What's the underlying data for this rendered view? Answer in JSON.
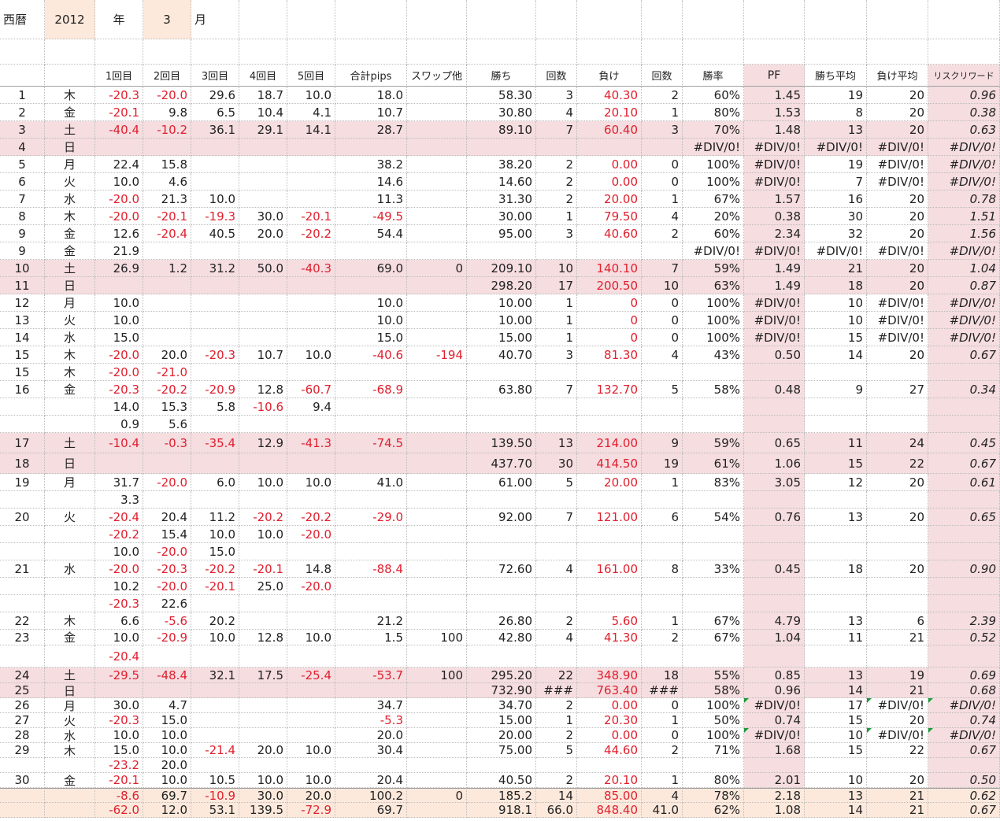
{
  "top": {
    "label_era": "西暦",
    "year": "2012",
    "label_year": "年",
    "month": "3",
    "label_month": "月"
  },
  "columns": [
    "",
    "",
    "1回目",
    "2回目",
    "3回目",
    "4回目",
    "5回目",
    "合計pips",
    "スワップ他",
    "勝ち",
    "回数",
    "負け",
    "回数",
    "勝率",
    "PF",
    "勝ち平均",
    "負け平均",
    "リスクリワード"
  ],
  "rows": [
    {
      "h": 22,
      "bg": "",
      "c": [
        "1",
        "木",
        "-20.3",
        "-20.0",
        "29.6",
        "18.7",
        "10.0",
        "18.0",
        "",
        "58.30",
        "3",
        "40.30",
        "2",
        "60%",
        "1.45",
        "19",
        "20",
        "0.96"
      ]
    },
    {
      "h": 22,
      "bg": "",
      "c": [
        "2",
        "金",
        "-20.1",
        "9.8",
        "6.5",
        "10.4",
        "4.1",
        "10.7",
        "",
        "30.80",
        "4",
        "20.10",
        "1",
        "80%",
        "1.53",
        "8",
        "20",
        "0.38"
      ]
    },
    {
      "h": 22,
      "bg": "pink",
      "c": [
        "3",
        "土",
        "-40.4",
        "-10.2",
        "36.1",
        "29.1",
        "14.1",
        "28.7",
        "",
        "89.10",
        "7",
        "60.40",
        "3",
        "70%",
        "1.48",
        "13",
        "20",
        "0.63"
      ]
    },
    {
      "h": 22,
      "bg": "pink",
      "c": [
        "4",
        "日",
        "",
        "",
        "",
        "",
        "",
        "",
        "",
        "",
        "",
        "",
        "",
        "#DIV/0!",
        "#DIV/0!",
        "#DIV/0!",
        "#DIV/0!",
        "#DIV/0!"
      ]
    },
    {
      "h": 22,
      "bg": "",
      "c": [
        "5",
        "月",
        "22.4",
        "15.8",
        "",
        "",
        "",
        "38.2",
        "",
        "38.20",
        "2",
        "0.00",
        "0",
        "100%",
        "#DIV/0!",
        "19",
        "#DIV/0!",
        "#DIV/0!"
      ]
    },
    {
      "h": 22,
      "bg": "",
      "c": [
        "6",
        "火",
        "10.0",
        "4.6",
        "",
        "",
        "",
        "14.6",
        "",
        "14.60",
        "2",
        "0.00",
        "0",
        "100%",
        "#DIV/0!",
        "7",
        "#DIV/0!",
        "#DIV/0!"
      ]
    },
    {
      "h": 22,
      "bg": "",
      "c": [
        "7",
        "水",
        "-20.0",
        "21.3",
        "10.0",
        "",
        "",
        "11.3",
        "",
        "31.30",
        "2",
        "20.00",
        "1",
        "67%",
        "1.57",
        "16",
        "20",
        "0.78"
      ]
    },
    {
      "h": 22,
      "bg": "",
      "c": [
        "8",
        "木",
        "-20.0",
        "-20.1",
        "-19.3",
        "30.0",
        "-20.1",
        "-49.5",
        "",
        "30.00",
        "1",
        "79.50",
        "4",
        "20%",
        "0.38",
        "30",
        "20",
        "1.51"
      ]
    },
    {
      "h": 22,
      "bg": "",
      "c": [
        "9",
        "金",
        "12.6",
        "-20.4",
        "40.5",
        "20.0",
        "-20.2",
        "54.4",
        "",
        "95.00",
        "3",
        "40.60",
        "2",
        "60%",
        "2.34",
        "32",
        "20",
        "1.56"
      ]
    },
    {
      "h": 22,
      "bg": "",
      "c": [
        "9",
        "金",
        "21.9",
        "",
        "",
        "",
        "",
        "",
        "",
        "",
        "",
        "",
        "",
        "#DIV/0!",
        "#DIV/0!",
        "#DIV/0!",
        "#DIV/0!",
        "#DIV/0!"
      ]
    },
    {
      "h": 22,
      "bg": "pink",
      "c": [
        "10",
        "土",
        "26.9",
        "1.2",
        "31.2",
        "50.0",
        "-40.3",
        "69.0",
        "0",
        "209.10",
        "10",
        "140.10",
        "7",
        "59%",
        "1.49",
        "21",
        "20",
        "1.04"
      ]
    },
    {
      "h": 22,
      "bg": "pink",
      "c": [
        "11",
        "日",
        "",
        "",
        "",
        "",
        "",
        "",
        "",
        "298.20",
        "17",
        "200.50",
        "10",
        "63%",
        "1.49",
        "18",
        "20",
        "0.87"
      ]
    },
    {
      "h": 22,
      "bg": "",
      "c": [
        "12",
        "月",
        "10.0",
        "",
        "",
        "",
        "",
        "10.0",
        "",
        "10.00",
        "1",
        "0",
        "0",
        "100%",
        "#DIV/0!",
        "10",
        "#DIV/0!",
        "#DIV/0!"
      ]
    },
    {
      "h": 22,
      "bg": "",
      "c": [
        "13",
        "火",
        "10.0",
        "",
        "",
        "",
        "",
        "10.0",
        "",
        "10.00",
        "1",
        "0",
        "0",
        "100%",
        "#DIV/0!",
        "10",
        "#DIV/0!",
        "#DIV/0!"
      ]
    },
    {
      "h": 22,
      "bg": "",
      "c": [
        "14",
        "水",
        "15.0",
        "",
        "",
        "",
        "",
        "15.0",
        "",
        "15.00",
        "1",
        "0",
        "0",
        "100%",
        "#DIV/0!",
        "15",
        "#DIV/0!",
        "#DIV/0!"
      ]
    },
    {
      "h": 22,
      "bg": "",
      "c": [
        "15",
        "木",
        "-20.0",
        "20.0",
        "-20.3",
        "10.7",
        "10.0",
        "-40.6",
        "-194",
        "40.70",
        "3",
        "81.30",
        "4",
        "43%",
        "0.50",
        "14",
        "20",
        "0.67"
      ]
    },
    {
      "h": 22,
      "bg": "",
      "c": [
        "15",
        "木",
        "-20.0",
        "-21.0",
        "",
        "",
        "",
        "",
        "",
        "",
        "",
        "",
        "",
        "",
        "",
        "",
        "",
        ""
      ]
    },
    {
      "h": 22,
      "bg": "",
      "c": [
        "16",
        "金",
        "-20.3",
        "-20.2",
        "-20.9",
        "12.8",
        "-60.7",
        "-68.9",
        "",
        "63.80",
        "7",
        "132.70",
        "5",
        "58%",
        "0.48",
        "9",
        "27",
        "0.34"
      ]
    },
    {
      "h": 22,
      "bg": "",
      "c": [
        "",
        "",
        "14.0",
        "15.3",
        "5.8",
        "-10.6",
        "9.4",
        "",
        "",
        "",
        "",
        "",
        "",
        "",
        "",
        "",
        "",
        ""
      ]
    },
    {
      "h": 22,
      "bg": "",
      "c": [
        "",
        "",
        "0.9",
        "5.6",
        "",
        "",
        "",
        "",
        "",
        "",
        "",
        "",
        "",
        "",
        "",
        "",
        "",
        ""
      ]
    },
    {
      "h": 26,
      "bg": "pink",
      "c": [
        "17",
        "土",
        "-10.4",
        "-0.3",
        "-35.4",
        "12.9",
        "-41.3",
        "-74.5",
        "",
        "139.50",
        "13",
        "214.00",
        "9",
        "59%",
        "0.65",
        "11",
        "24",
        "0.45"
      ]
    },
    {
      "h": 26,
      "bg": "pink",
      "c": [
        "18",
        "日",
        "",
        "",
        "",
        "",
        "",
        "",
        "",
        "437.70",
        "30",
        "414.50",
        "19",
        "61%",
        "1.06",
        "15",
        "22",
        "0.67"
      ]
    },
    {
      "h": 22,
      "bg": "",
      "c": [
        "19",
        "月",
        "31.7",
        "-20.0",
        "6.0",
        "10.0",
        "10.0",
        "41.0",
        "",
        "61.00",
        "5",
        "20.00",
        "1",
        "83%",
        "3.05",
        "12",
        "20",
        "0.61"
      ]
    },
    {
      "h": 22,
      "bg": "",
      "c": [
        "",
        "",
        "3.3",
        "",
        "",
        "",
        "",
        "",
        "",
        "",
        "",
        "",
        "",
        "",
        "",
        "",
        "",
        ""
      ]
    },
    {
      "h": 22,
      "bg": "",
      "c": [
        "20",
        "火",
        "-20.4",
        "20.4",
        "11.2",
        "-20.2",
        "-20.2",
        "-29.0",
        "",
        "92.00",
        "7",
        "121.00",
        "6",
        "54%",
        "0.76",
        "13",
        "20",
        "0.65"
      ]
    },
    {
      "h": 22,
      "bg": "",
      "c": [
        "",
        "",
        "-20.2",
        "15.4",
        "10.0",
        "10.0",
        "-20.0",
        "",
        "",
        "",
        "",
        "",
        "",
        "",
        "",
        "",
        "",
        ""
      ]
    },
    {
      "h": 22,
      "bg": "",
      "c": [
        "",
        "",
        "10.0",
        "-20.0",
        "15.0",
        "",
        "",
        "",
        "",
        "",
        "",
        "",
        "",
        "",
        "",
        "",
        "",
        ""
      ]
    },
    {
      "h": 22,
      "bg": "",
      "c": [
        "21",
        "水",
        "-20.0",
        "-20.3",
        "-20.2",
        "-20.1",
        "14.8",
        "-88.4",
        "",
        "72.60",
        "4",
        "161.00",
        "8",
        "33%",
        "0.45",
        "18",
        "20",
        "0.90"
      ]
    },
    {
      "h": 22,
      "bg": "",
      "c": [
        "",
        "",
        "10.2",
        "-20.0",
        "-20.1",
        "25.0",
        "-20.0",
        "",
        "",
        "",
        "",
        "",
        "",
        "",
        "",
        "",
        "",
        ""
      ]
    },
    {
      "h": 22,
      "bg": "",
      "c": [
        "",
        "",
        "-20.3",
        "22.6",
        "",
        "",
        "",
        "",
        "",
        "",
        "",
        "",
        "",
        "",
        "",
        "",
        "",
        ""
      ]
    },
    {
      "h": 22,
      "bg": "",
      "c": [
        "22",
        "木",
        "6.6",
        "-5.6",
        "20.2",
        "",
        "",
        "21.2",
        "",
        "26.80",
        "2",
        "5.60",
        "1",
        "67%",
        "4.79",
        "13",
        "6",
        "2.39"
      ]
    },
    {
      "h": 20,
      "bg": "",
      "c": [
        "23",
        "金",
        "10.0",
        "-20.9",
        "10.0",
        "12.8",
        "10.0",
        "1.5",
        "100",
        "42.80",
        "4",
        "41.30",
        "2",
        "67%",
        "1.04",
        "11",
        "21",
        "0.52"
      ]
    },
    {
      "h": 28,
      "bg": "",
      "c": [
        "",
        "",
        "-20.4",
        "",
        "",
        "",
        "",
        "",
        "",
        "",
        "",
        "",
        "",
        "",
        "",
        "",
        "",
        ""
      ]
    },
    {
      "h": 20,
      "bg": "pink",
      "c": [
        "24",
        "土",
        "-29.5",
        "-48.4",
        "32.1",
        "17.5",
        "-25.4",
        "-53.7",
        "100",
        "295.20",
        "22",
        "348.90",
        "18",
        "55%",
        "0.85",
        "13",
        "19",
        "0.69"
      ]
    },
    {
      "h": 19,
      "bg": "pink",
      "c": [
        "25",
        "日",
        "",
        "",
        "",
        "",
        "",
        "",
        "",
        "732.90",
        "###",
        "763.40",
        "###",
        "58%",
        "0.96",
        "14",
        "21",
        "0.68"
      ]
    },
    {
      "h": 19,
      "bg": "",
      "c": [
        "26",
        "月",
        "30.0",
        "4.7",
        "",
        "",
        "",
        "34.7",
        "",
        "34.70",
        "2",
        "0.00",
        "0",
        "100%",
        "#DIV/0!",
        "17",
        "#DIV/0!",
        "#DIV/0!"
      ]
    },
    {
      "h": 19,
      "bg": "",
      "c": [
        "27",
        "火",
        "-20.3",
        "15.0",
        "",
        "",
        "",
        "-5.3",
        "",
        "15.00",
        "1",
        "20.30",
        "1",
        "50%",
        "0.74",
        "15",
        "20",
        "0.74"
      ]
    },
    {
      "h": 19,
      "bg": "",
      "c": [
        "28",
        "水",
        "10.0",
        "10.0",
        "",
        "",
        "",
        "20.0",
        "",
        "20.00",
        "2",
        "0.00",
        "0",
        "100%",
        "#DIV/0!",
        "10",
        "#DIV/0!",
        "#DIV/0!"
      ]
    },
    {
      "h": 19,
      "bg": "",
      "c": [
        "29",
        "木",
        "15.0",
        "10.0",
        "-21.4",
        "20.0",
        "10.0",
        "30.4",
        "",
        "75.00",
        "5",
        "44.60",
        "2",
        "71%",
        "1.68",
        "15",
        "22",
        "0.67"
      ]
    },
    {
      "h": 19,
      "bg": "",
      "c": [
        "",
        "",
        "-23.2",
        "20.0",
        "",
        "",
        "",
        "",
        "",
        "",
        "",
        "",
        "",
        "",
        "",
        "",
        "",
        ""
      ]
    },
    {
      "h": 19,
      "bg": "",
      "c": [
        "30",
        "金",
        "-20.1",
        "10.0",
        "10.5",
        "10.0",
        "10.0",
        "20.4",
        "",
        "40.50",
        "2",
        "20.10",
        "1",
        "80%",
        "2.01",
        "10",
        "20",
        "0.50"
      ]
    },
    {
      "h": 19,
      "bg": "peach",
      "c": [
        "",
        "",
        "-8.6",
        "69.7",
        "-10.9",
        "30.0",
        "20.0",
        "100.2",
        "0",
        "185.2",
        "14",
        "85.00",
        "4",
        "78%",
        "2.18",
        "13",
        "21",
        "0.62"
      ]
    },
    {
      "h": 19,
      "bg": "peach",
      "c": [
        "",
        "",
        "-62.0",
        "12.0",
        "53.1",
        "139.5",
        "-72.9",
        "69.7",
        "",
        "918.1",
        "66.0",
        "848.40",
        "41.0",
        "62%",
        "1.08",
        "14",
        "21",
        "0.67"
      ]
    }
  ],
  "colors": {
    "weekend_fill": "#f5dde0",
    "pf_fill": "#f5dde0",
    "total_fill": "#fde9dc",
    "negative": "#e0202e",
    "comment_marker": "#1a9a3a"
  },
  "comment_markers": [
    {
      "row": 35,
      "col": 14
    },
    {
      "row": 35,
      "col": 16
    },
    {
      "row": 35,
      "col": 17
    },
    {
      "row": 37,
      "col": 14
    },
    {
      "row": 37,
      "col": 16
    },
    {
      "row": 37,
      "col": 17
    }
  ]
}
